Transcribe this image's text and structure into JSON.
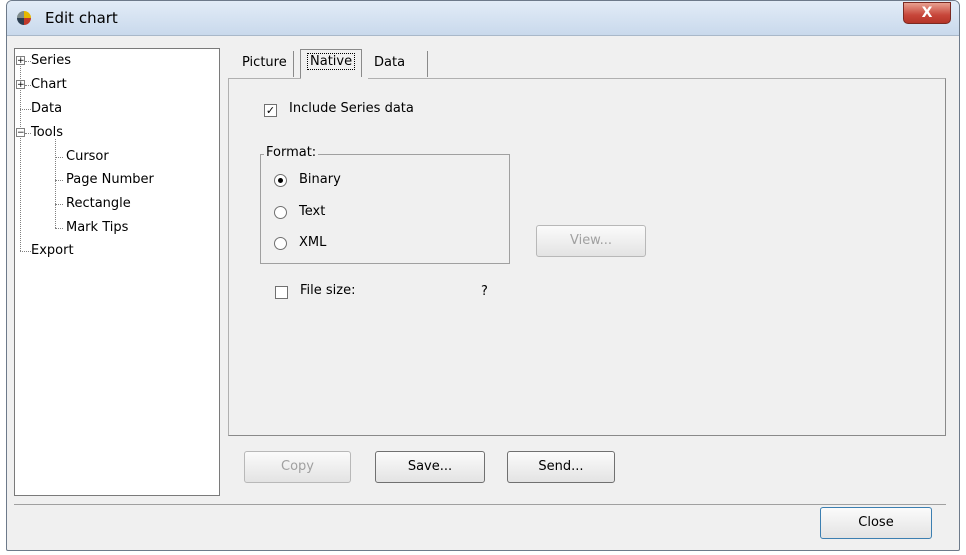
{
  "window": {
    "title": "Edit chart",
    "close_glyph": "X"
  },
  "tree": {
    "items": [
      {
        "label": "Series",
        "expander": "+"
      },
      {
        "label": "Chart",
        "expander": "+"
      },
      {
        "label": "Data"
      },
      {
        "label": "Tools",
        "expander": "−"
      },
      {
        "label": "Cursor"
      },
      {
        "label": "Page Number"
      },
      {
        "label": "Rectangle"
      },
      {
        "label": "Mark Tips"
      },
      {
        "label": "Export",
        "selected": true
      }
    ]
  },
  "tabs": [
    {
      "label": "Picture"
    },
    {
      "label": "Native",
      "active": true
    },
    {
      "label": "Data"
    }
  ],
  "native": {
    "include_series": {
      "label": "Include Series data",
      "checked": true
    },
    "format": {
      "legend": "Format:",
      "options": [
        {
          "label": "Binary",
          "selected": true
        },
        {
          "label": "Text"
        },
        {
          "label": "XML"
        }
      ]
    },
    "view_button": "View...",
    "file_size": {
      "label": "File size:",
      "checked": false,
      "value": "?"
    }
  },
  "actions": {
    "copy": "Copy",
    "save": "Save...",
    "send": "Send..."
  },
  "footer": {
    "close": "Close"
  },
  "colors": {
    "title_gradient_top": "#e2ecf7",
    "close_button": "#c7463a",
    "panel_bg": "#f0f0f0"
  }
}
